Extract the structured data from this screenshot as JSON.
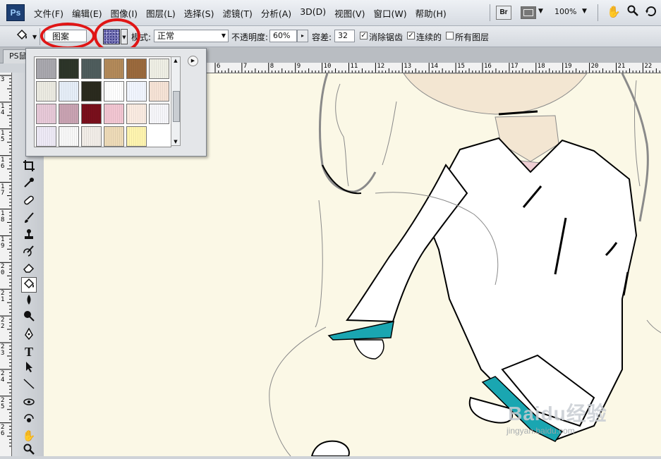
{
  "app": {
    "logo": "Ps"
  },
  "menu": [
    "文件(F)",
    "编辑(E)",
    "图像(I)",
    "图层(L)",
    "选择(S)",
    "滤镜(T)",
    "分析(A)",
    "3D(D)",
    "视图(V)",
    "窗口(W)",
    "帮助(H)"
  ],
  "menubar_right": {
    "bridge_label": "Br",
    "zoom": "100%",
    "icons": [
      "hand-icon",
      "zoom-icon",
      "rotate-icon"
    ]
  },
  "options": {
    "tool_icon": "paint-bucket-icon",
    "fill_source": "图案",
    "mode_label": "模式:",
    "mode_value": "正常",
    "opacity_label": "不透明度:",
    "opacity_value": "60%",
    "tolerance_label": "容差:",
    "tolerance_value": "32",
    "anti_alias_label": "消除锯齿",
    "anti_alias_checked": true,
    "contiguous_label": "连续的",
    "contiguous_checked": true,
    "all_layers_label": "所有图层",
    "all_layers_checked": false,
    "highlight_color": "#e01515"
  },
  "doc_tab": {
    "label": "PS鼠"
  },
  "rulers": {
    "top": [
      "6",
      "7",
      "8",
      "9",
      "10",
      "11",
      "12",
      "13",
      "14",
      "15",
      "16",
      "17",
      "18",
      "19",
      "20",
      "21",
      "22"
    ],
    "left": [
      "3",
      "1 4",
      "1 5",
      "1 6",
      "1 7",
      "1 8",
      "1 9",
      "2 0",
      "2 1",
      "2 2",
      "2 3",
      "2 4",
      "2 5",
      "2 6"
    ]
  },
  "tools": [
    "crop-icon",
    "eyedropper-icon",
    "healing-brush-icon",
    "brush-icon",
    "clone-stamp-icon",
    "history-brush-icon",
    "eraser-icon",
    "paint-bucket-icon",
    "blur-icon",
    "dodge-icon",
    "pen-icon",
    "type-icon",
    "path-selection-icon",
    "line-icon",
    "3d-rotate-icon",
    "3d-orbit-icon",
    "hand-icon",
    "zoom-icon"
  ],
  "active_tool": "paint-bucket-icon",
  "pattern_picker": {
    "patterns": [
      "#a9a8ae",
      "#2d3529",
      "#4f5d5d",
      "#b38a5a",
      "#9b6a3d",
      "#efefe5",
      "#ecebe2",
      "#e6eef8",
      "#2a2a1e",
      "#ffffff",
      "#f2f6ff",
      "#f6e3d6",
      "#e7c9d8",
      "#c9a3b2",
      "#7a0f1c",
      "#f2c6d2",
      "#fbece2",
      "#f6f6fa",
      "#eeeaf6",
      "#f8f8f8",
      "#f2ede8",
      "#eedbb8",
      "#fff5b0"
    ]
  },
  "canvas": {
    "background": "#fbf8e6",
    "colors": {
      "line": "#000000",
      "gray_line": "#8a8a8a",
      "cuff": "#1aa6b1",
      "collar": "#efcfd4",
      "skin": "#f3e6d2",
      "white": "#ffffff"
    }
  },
  "watermark": {
    "text": "Baidu经验",
    "sub": "jingyan.baidu.com"
  }
}
